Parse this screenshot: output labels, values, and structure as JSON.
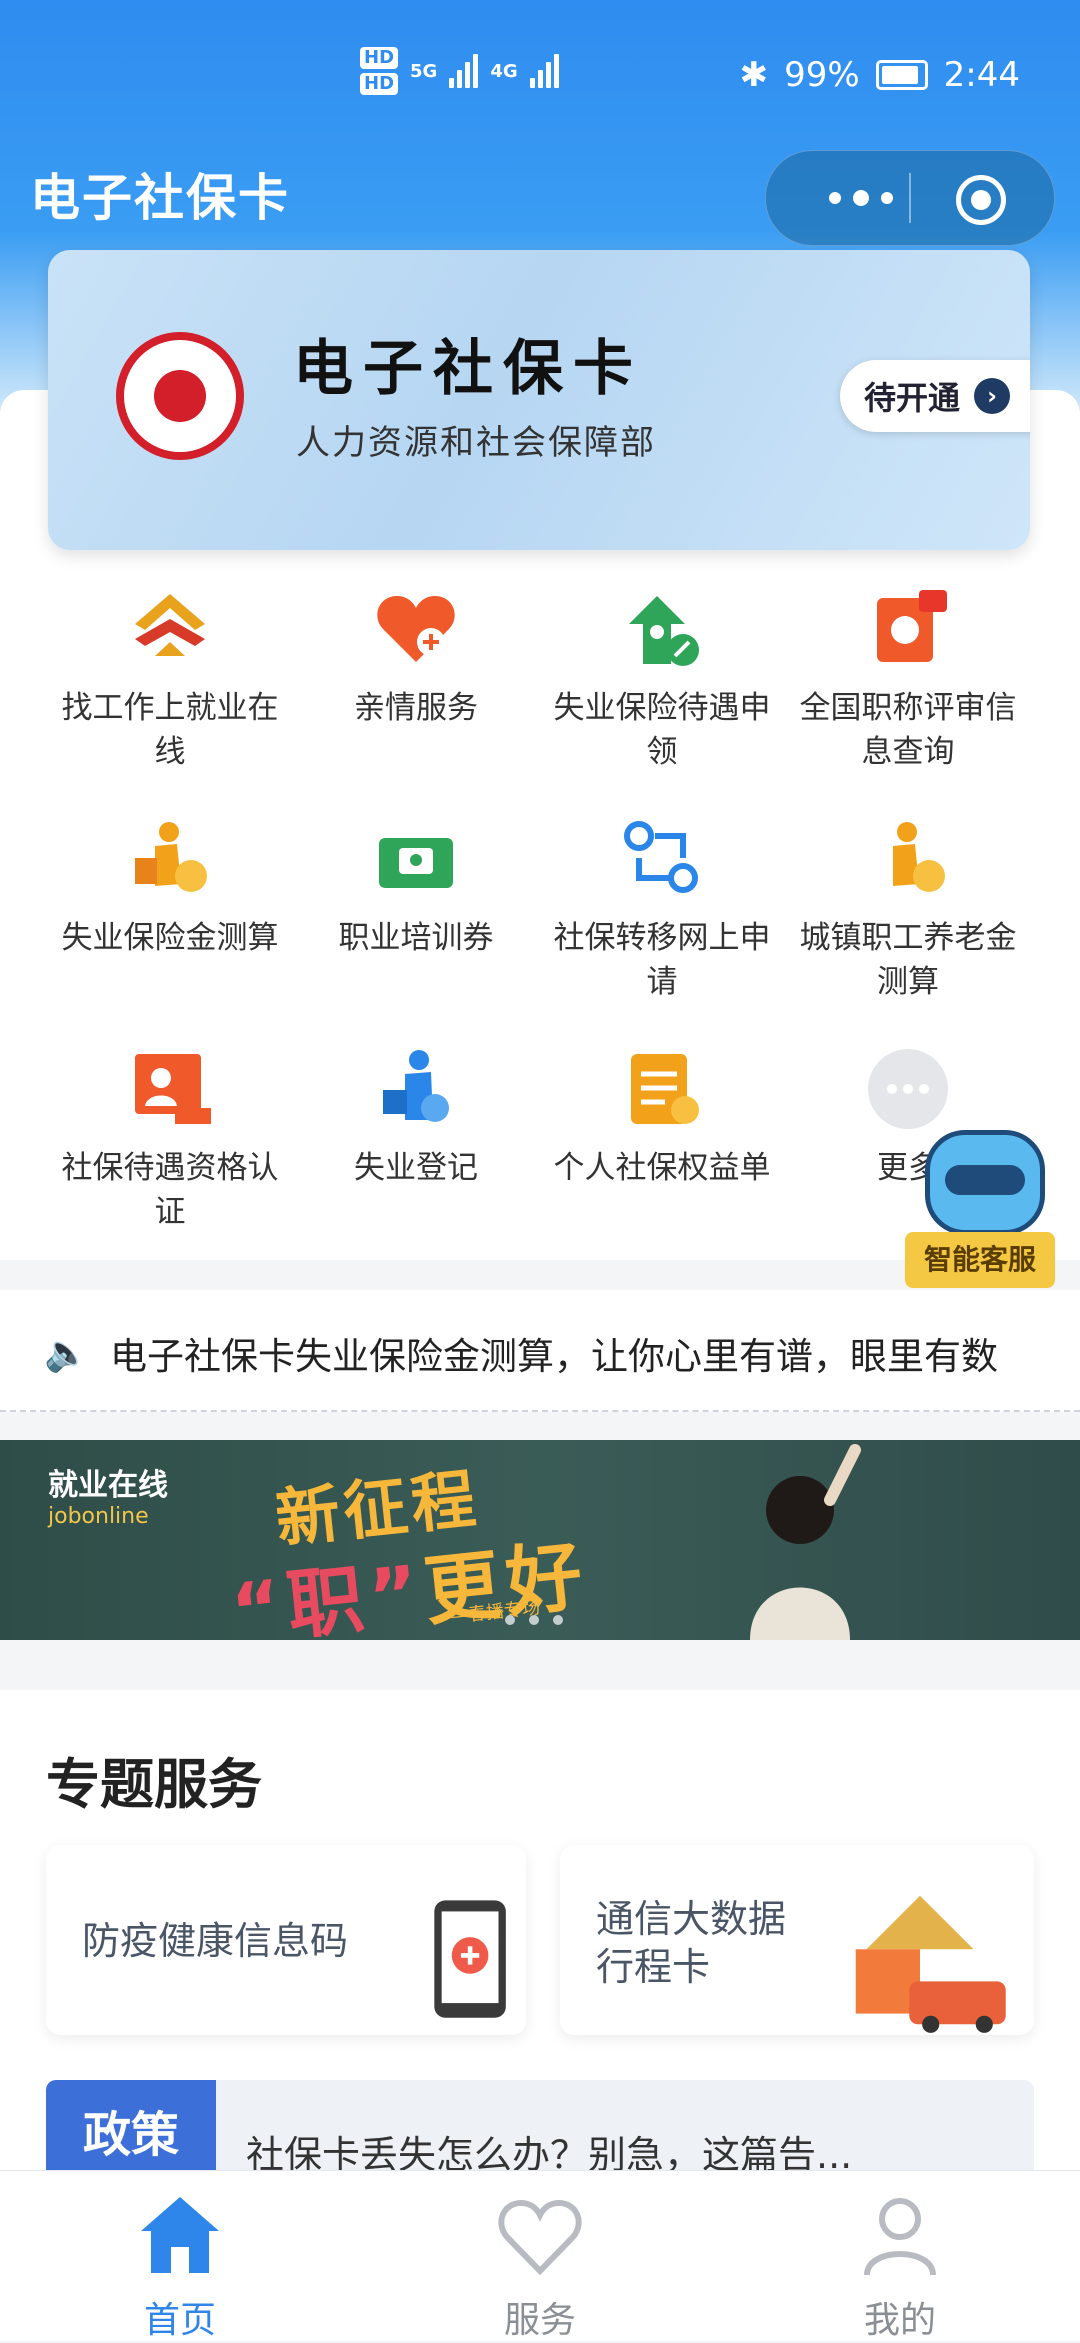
{
  "status_bar": {
    "hd1": "HD",
    "hd2": "HD",
    "net1": "5G",
    "net2": "4G",
    "battery_pct": "99%",
    "time": "2:44"
  },
  "app": {
    "title": "电子社保卡"
  },
  "card": {
    "title": "电子社保卡",
    "subtitle": "人力资源和社会保障部",
    "action_label": "待开通"
  },
  "services": [
    {
      "label": "找工作上就业在线",
      "icon": "employment-online-icon",
      "color": "#e8a21b"
    },
    {
      "label": "亲情服务",
      "icon": "heart-plus-icon",
      "color": "#f0592a"
    },
    {
      "label": "失业保险待遇申领",
      "icon": "unemployment-claim-icon",
      "color": "#2fa55a"
    },
    {
      "label": "全国职称评审信息查询",
      "icon": "title-search-icon",
      "color": "#f0592a"
    },
    {
      "label": "失业保险金测算",
      "icon": "unemployment-calc-icon",
      "color": "#f2a21a"
    },
    {
      "label": "职业培训券",
      "icon": "training-ticket-icon",
      "color": "#2fa55a"
    },
    {
      "label": "社保转移网上申请",
      "icon": "transfer-icon",
      "color": "#2a86e8"
    },
    {
      "label": "城镇职工养老金测算",
      "icon": "pension-calc-icon",
      "color": "#f2a21a"
    },
    {
      "label": "社保待遇资格认证",
      "icon": "qualification-icon",
      "color": "#f0592a"
    },
    {
      "label": "失业登记",
      "icon": "unemployment-register-icon",
      "color": "#2a86e8"
    },
    {
      "label": "个人社保权益单",
      "icon": "rights-statement-icon",
      "color": "#f2a21a"
    },
    {
      "label": "更多",
      "icon": "more-icon",
      "color": "#c5c9cf"
    }
  ],
  "assistant": {
    "label": "智能客服"
  },
  "notice": {
    "text": "电子社保卡失业保险金测算，让你心里有谱，眼里有数"
  },
  "banner": {
    "logo_cn": "就业在线",
    "logo_en": "jobonline",
    "line1": "新征程",
    "line2_quote": "“职”",
    "line2_rest": "更好",
    "sub": "—春播专场"
  },
  "special": {
    "title": "专题服务",
    "items": [
      {
        "label": "防疫健康信息码"
      },
      {
        "label_line1": "通信大数据",
        "label_line2": "行程卡"
      }
    ],
    "policy_badge": "政策",
    "policy_text": "社保卡丢失怎么办？别急，这篇告..."
  },
  "tabs": [
    {
      "label": "首页",
      "icon": "home-icon",
      "active": true
    },
    {
      "label": "服务",
      "icon": "heart-icon",
      "active": false
    },
    {
      "label": "我的",
      "icon": "user-icon",
      "active": false
    }
  ],
  "colors": {
    "primary": "#2f86ea",
    "header": "#2f8cf0"
  }
}
